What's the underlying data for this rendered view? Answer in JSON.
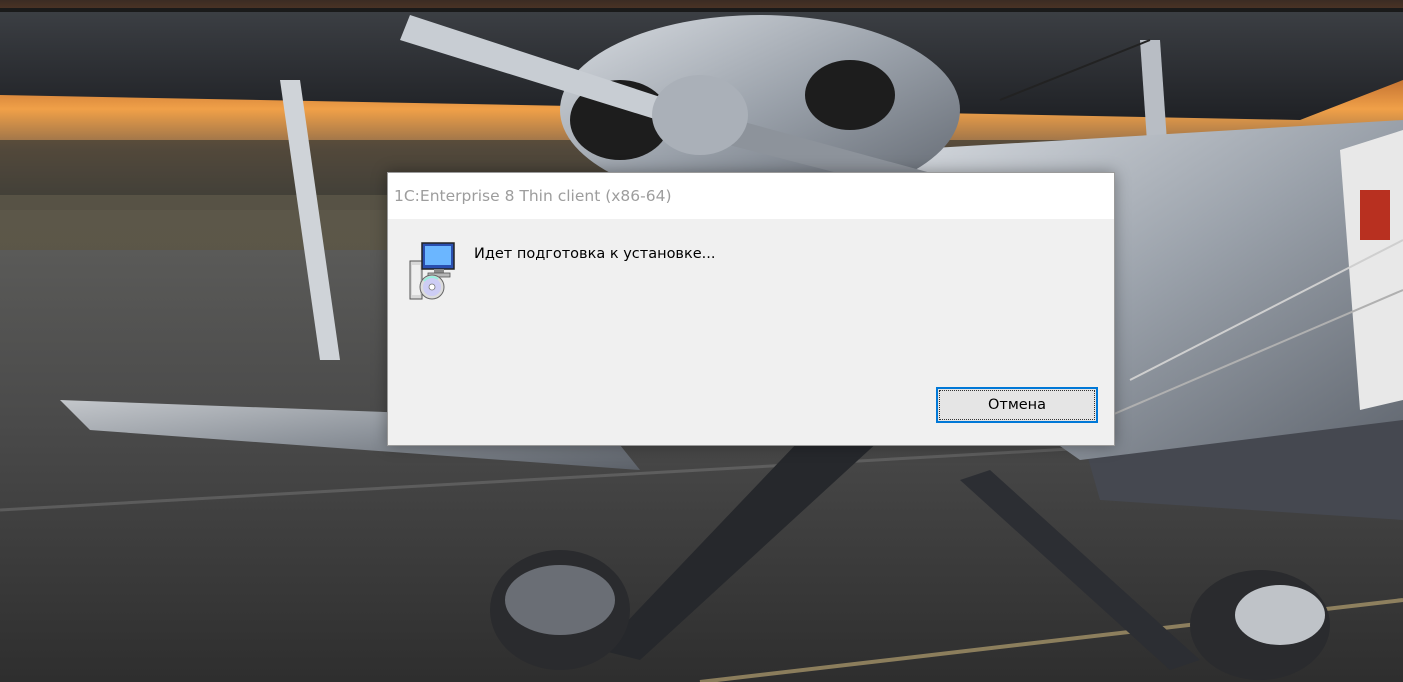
{
  "window": {
    "title": "1C:Enterprise 8 Thin client (x86-64)"
  },
  "dialog": {
    "icon": "setup-installer-icon",
    "message": "Идет подготовка к установке...",
    "cancel_label": "Отмена"
  },
  "desktop": {
    "wallpaper": "biplane-at-sunset-wallpaper"
  },
  "colors": {
    "dialog_background": "#f0f0f0",
    "titlebar_background": "#ffffff",
    "title_text": "#9d9d9d",
    "button_focus_border": "#0078d7"
  }
}
